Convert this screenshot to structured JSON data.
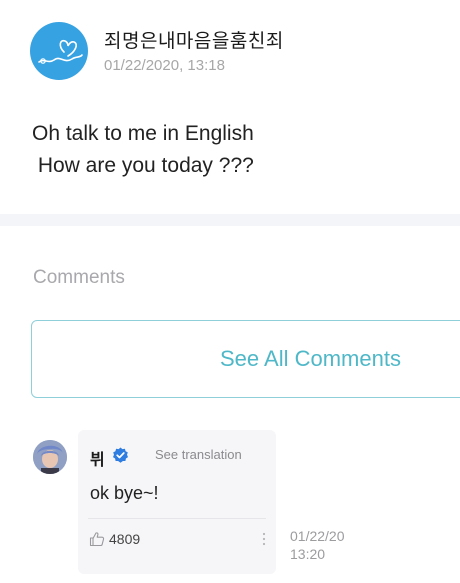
{
  "post": {
    "author": "죄명은내마음을훔친죄",
    "timestamp": "01/22/2020, 13:18",
    "lines": [
      "Oh talk to me in English",
      " How are you today ???"
    ]
  },
  "comments_section": {
    "heading": "Comments",
    "see_all_label": "See All Comments"
  },
  "comment": {
    "author": "뷔",
    "verified_icon": "verified-check-icon",
    "see_translation": "See translation",
    "text": "ok bye~!",
    "like_icon": "thumbs-up-icon",
    "likes": "4809",
    "more_icon": "more-options-icon",
    "time_date": "01/22/20",
    "time_clock": "13:20"
  },
  "colors": {
    "accent": "#4fb8c8",
    "avatar_blue": "#37a2e2",
    "verified_blue": "#2f7de1"
  }
}
